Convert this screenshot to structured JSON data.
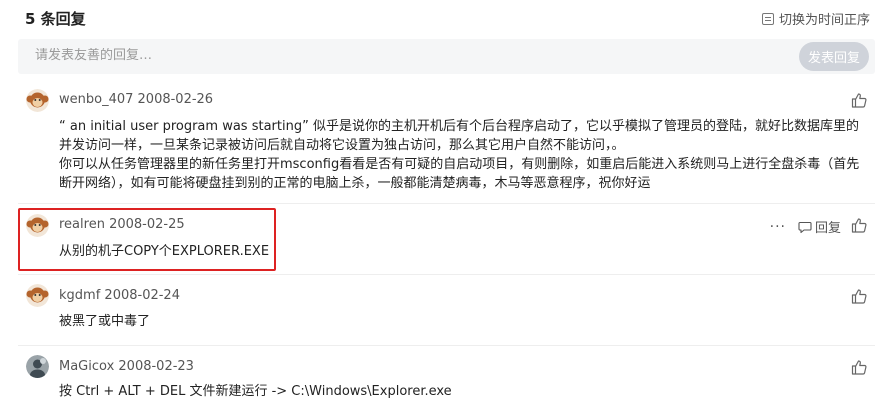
{
  "header": {
    "reply_count": "5 条回复",
    "sort_label": "切换为时间正序"
  },
  "reply_box": {
    "placeholder": "请发表友善的回复…",
    "post_button": "发表回复"
  },
  "comments": [
    {
      "user": "wenbo_407",
      "date": "2008-02-26",
      "lines": [
        "“ an initial user program was starting” 似乎是说你的主机开机后有个后台程序启动了，它以乎模拟了管理员的登陆，就好比数据库里的并发访问一样，一旦某条记录被访问后就自动将它设置为独占访问，那么其它用户自然不能访问，。",
        "你可以从任务管理器里的新任务里打开msconfig看看是否有可疑的自启动项目，有则删除，如重启后能进入系统则马上进行全盘杀毒（首先断开网络），如有可能将硬盘挂到别的正常的电脑上杀，一般都能清楚病毒，木马等恶意程序，祝你好运"
      ]
    },
    {
      "user": "realren",
      "date": "2008-02-25",
      "lines": [
        "从别的机子COPY个EXPLORER.EXE"
      ],
      "actions": {
        "more": "···",
        "reply": "回复"
      }
    },
    {
      "user": "kgdmf",
      "date": "2008-02-24",
      "lines": [
        "被黑了或中毒了"
      ]
    },
    {
      "user": "MaGicox",
      "date": "2008-02-23",
      "lines": [
        "按 Ctrl + ALT + DEL 文件新建运行 -> C:\\Windows\\Explorer.exe"
      ]
    }
  ],
  "colors": {
    "highlight": "#dd2222",
    "avatar_monkey": "#b4642d",
    "post_button_bg": "#cfd3da"
  }
}
